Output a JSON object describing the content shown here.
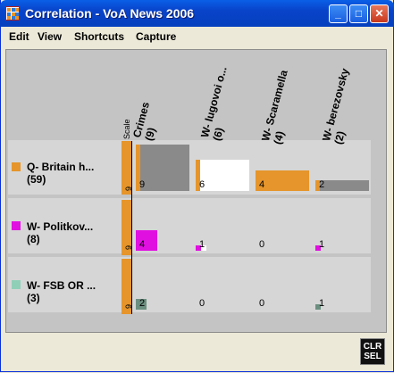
{
  "window": {
    "title": "Correlation - VoA News 2006",
    "buttons": {
      "minimize": "_",
      "maximize": "□",
      "close": "✕"
    }
  },
  "menu": {
    "items": [
      {
        "label": "Edit"
      },
      {
        "label": "View"
      },
      {
        "label": "Shortcuts"
      },
      {
        "label": "Capture"
      }
    ]
  },
  "matrix": {
    "scale_label": "Scale",
    "columns": [
      {
        "line1": "Crimes",
        "line2": "(9)"
      },
      {
        "line1": "W- lugovoi o...",
        "line2": "(6)"
      },
      {
        "line1": "W- Scaramella",
        "line2": "(4)"
      },
      {
        "line1": "W- berezovsky",
        "line2": "(2)"
      }
    ],
    "rows": [
      {
        "label": "Q- Britain h...",
        "count": "(59)",
        "color": "#e5952b",
        "scale": "9",
        "cells": [
          "9",
          "6",
          "4",
          "2"
        ],
        "fill": [
          1.0,
          0.667,
          0.444,
          0.222
        ]
      },
      {
        "label": "W- Politkov...",
        "count": "(8)",
        "color": "#e010e0",
        "scale": "9",
        "cells": [
          "4",
          "1",
          "0",
          "1"
        ],
        "fill": [
          0.444,
          0.111,
          0,
          0.111
        ]
      },
      {
        "label": "W- FSB OR ...",
        "count": "(3)",
        "color": "#8fcfb8",
        "scale": "9",
        "cells": [
          "2",
          "0",
          "0",
          "1"
        ],
        "fill": [
          0.222,
          0,
          0,
          0.111
        ]
      }
    ]
  },
  "footer": {
    "clr_line1": "CLR",
    "clr_line2": "SEL"
  }
}
